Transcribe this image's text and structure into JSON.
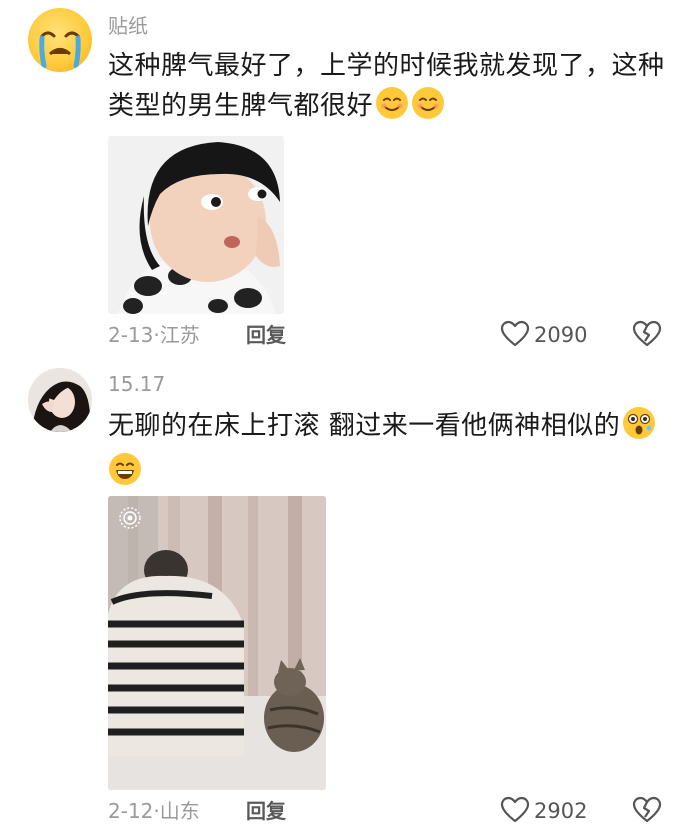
{
  "comments": [
    {
      "username": "贴纸",
      "text": "这种脾气最好了，上学的时候我就发现了，这种类型的男生脾气都很好",
      "emojis": [
        "smile-emoji",
        "smile-emoji"
      ],
      "date": "2-13",
      "region": "江苏",
      "separator": "·",
      "reply_label": "回复",
      "likes": "2090"
    },
    {
      "username": "15.17",
      "text": "无聊的在床上打滚 翻过来一看他俩神相似的",
      "emojis": [
        "surprised-emoji",
        "grin-emoji"
      ],
      "date": "2-12",
      "region": "山东",
      "separator": "·",
      "reply_label": "回复",
      "likes": "2902"
    }
  ],
  "colors": {
    "meta_gray": "#9a9a9a",
    "emoji_yellow": "#ffc93a",
    "text_dark": "#1a1a1a"
  }
}
